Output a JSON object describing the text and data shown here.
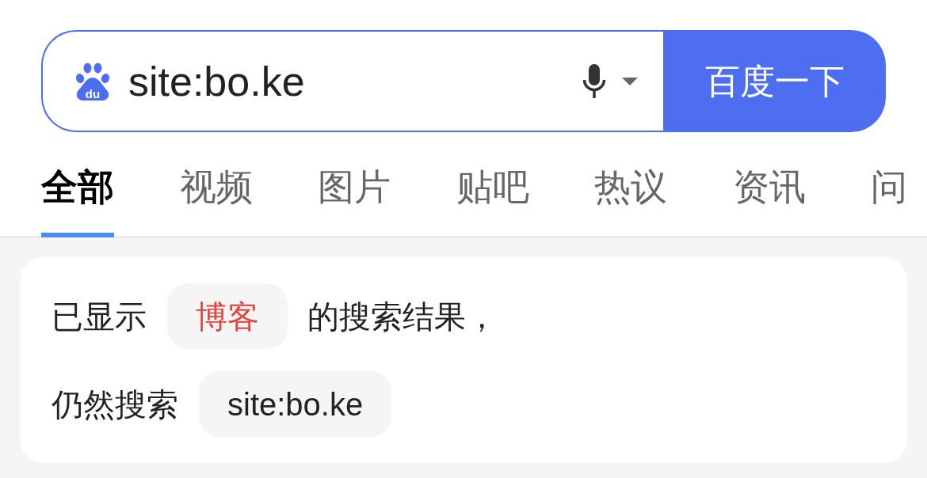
{
  "search": {
    "logo_text": "du",
    "query": "site:bo.ke",
    "button": "百度一下"
  },
  "tabs": [
    {
      "label": "全部",
      "selected": true
    },
    {
      "label": "视频",
      "selected": false
    },
    {
      "label": "图片",
      "selected": false
    },
    {
      "label": "贴吧",
      "selected": false
    },
    {
      "label": "热议",
      "selected": false
    },
    {
      "label": "资讯",
      "selected": false
    },
    {
      "label": "问",
      "selected": false
    }
  ],
  "notice": {
    "lines": [
      {
        "kind": "corrected",
        "prefix": "已显示",
        "chip": "博客",
        "suffix": "的搜索结果，"
      },
      {
        "kind": "original",
        "prefix": "仍然搜索",
        "chip": "site:bo.ke"
      }
    ]
  }
}
